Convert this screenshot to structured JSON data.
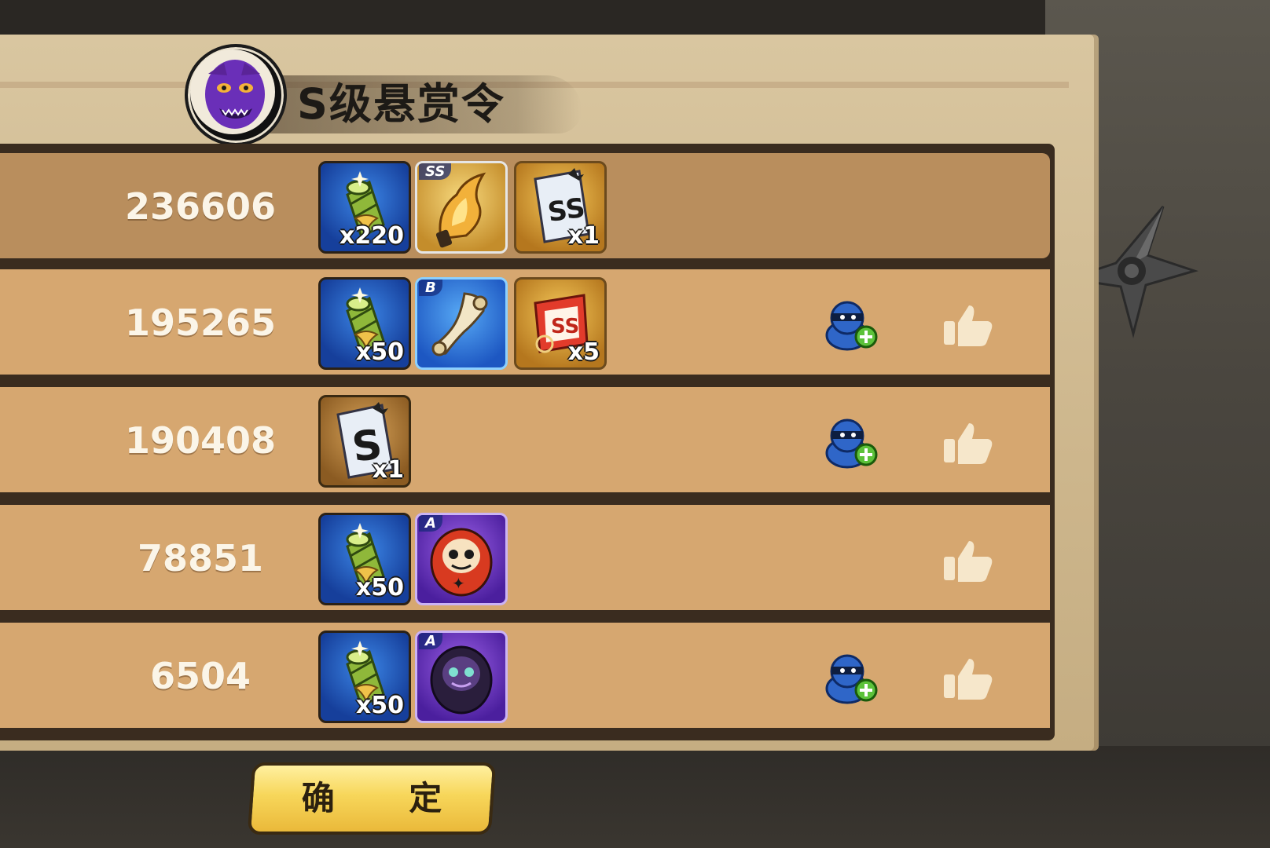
{
  "title": "S级悬赏令",
  "confirm_label": "确 定",
  "rows": [
    {
      "score": "236606",
      "items": [
        {
          "icon": "bamboo-scroll-icon",
          "count": "x220"
        },
        {
          "icon": "golden-flame-weapon-icon",
          "count": "",
          "grade": "SS"
        },
        {
          "icon": "ss-bounty-paper-icon",
          "count": "x1"
        }
      ],
      "add_friend": false,
      "like": false
    },
    {
      "score": "195265",
      "items": [
        {
          "icon": "bamboo-scroll-icon",
          "count": "x50"
        },
        {
          "icon": "paper-scroll-icon",
          "count": "",
          "grade": "B"
        },
        {
          "icon": "red-ticket-icon",
          "count": "x5"
        }
      ],
      "add_friend": true,
      "like": true
    },
    {
      "score": "190408",
      "items": [
        {
          "icon": "s-bounty-paper-icon",
          "count": "x1"
        }
      ],
      "add_friend": true,
      "like": true
    },
    {
      "score": "78851",
      "items": [
        {
          "icon": "bamboo-scroll-icon",
          "count": "x50"
        },
        {
          "icon": "red-daruma-icon",
          "count": "",
          "grade": "A"
        }
      ],
      "add_friend": false,
      "like": true
    },
    {
      "score": "6504",
      "items": [
        {
          "icon": "bamboo-scroll-icon",
          "count": "x50"
        },
        {
          "icon": "dark-daruma-icon",
          "count": "",
          "grade": "A"
        }
      ],
      "add_friend": true,
      "like": true
    }
  ]
}
